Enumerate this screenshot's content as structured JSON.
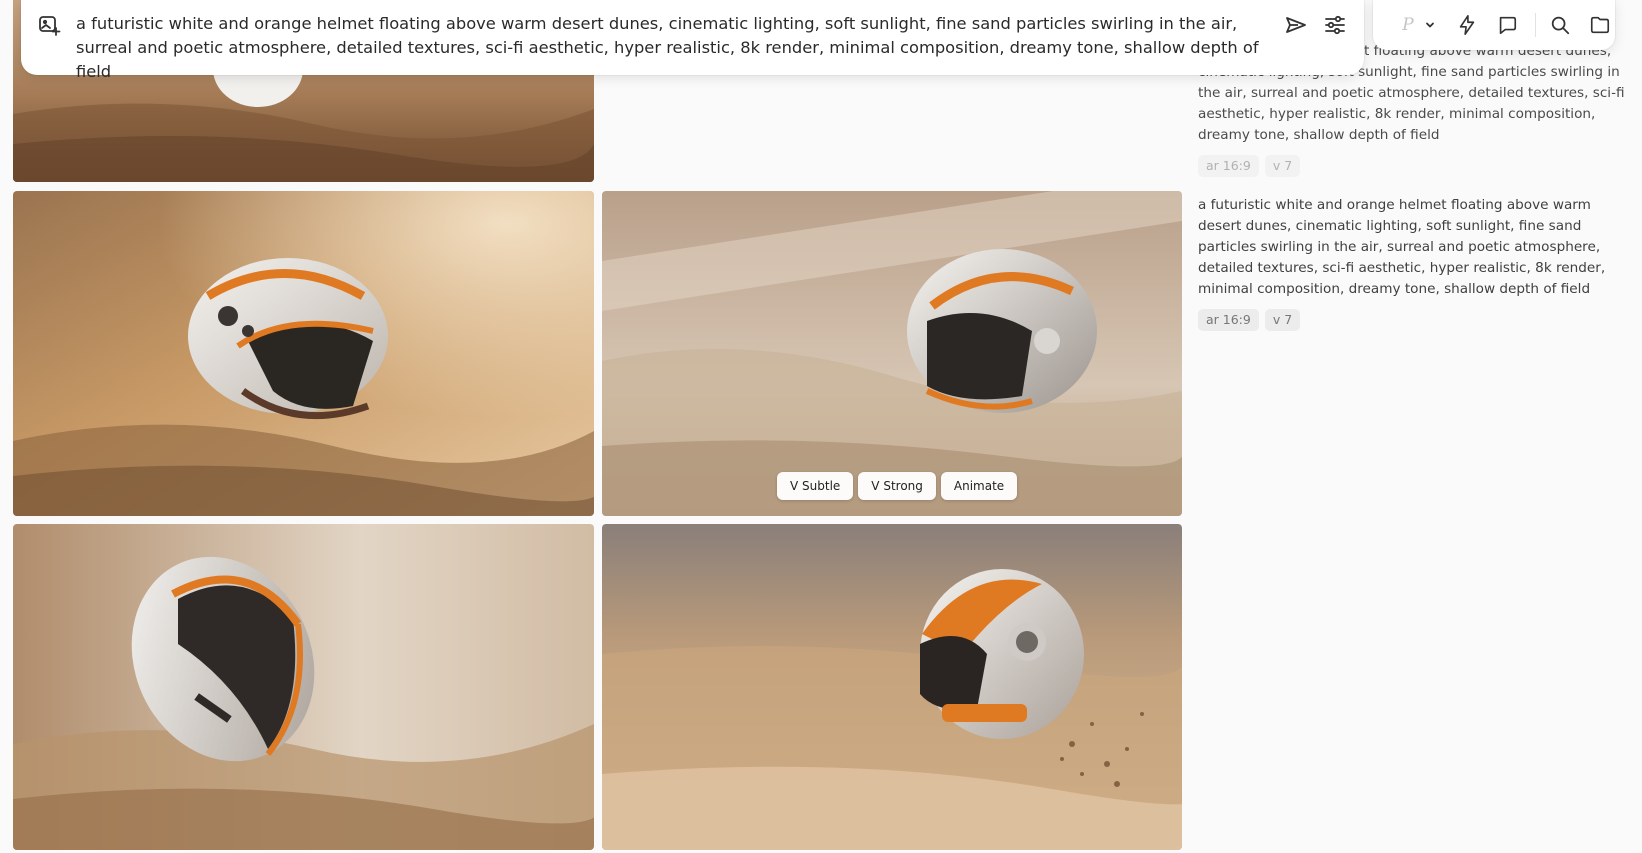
{
  "prompt_bar": {
    "prompt_text": "a futuristic white and orange helmet floating above warm desert dunes, cinematic lighting, soft sunlight, fine sand particles swirling in the air, surreal and poetic atmosphere, detailed textures, sci-fi aesthetic, hyper realistic, 8k render, minimal composition, dreamy tone, shallow depth of field",
    "icons": [
      "image-prompt-icon",
      "send-icon",
      "settings-sliders-icon"
    ]
  },
  "tool_bar": {
    "personalize_letter": "P",
    "icons": [
      "chevron-down-icon",
      "lightning-icon",
      "chat-icon",
      "search-icon",
      "folder-icon"
    ]
  },
  "right_panel": {
    "previous_prompt": {
      "visible_text": "white and orange helmet floating above warm desert dunes, cinematic lighting, soft sunlight, fine sand particles swirling in the air, surreal and poetic atmosphere, detailed textures, sci-fi aesthetic, hyper realistic, 8k render, minimal composition, dreamy tone, shallow depth of field",
      "tags": [
        "ar 16:9",
        "v 7"
      ]
    },
    "current_prompt": {
      "text": "a futuristic white and orange helmet floating above warm desert dunes, cinematic lighting, soft sunlight, fine sand particles swirling in the air, surreal and poetic atmosphere, detailed textures, sci-fi aesthetic, hyper realistic, 8k render, minimal composition, dreamy tone, shallow depth of field",
      "tags": [
        "ar 16:9",
        "v 7"
      ]
    }
  },
  "hover_actions": {
    "v_subtle": "V Subtle",
    "v_strong": "V Strong",
    "animate": "Animate"
  },
  "colors": {
    "page_background": "#fafafa",
    "tag_background": "#ececec",
    "accent_orange": "#e07a22"
  }
}
